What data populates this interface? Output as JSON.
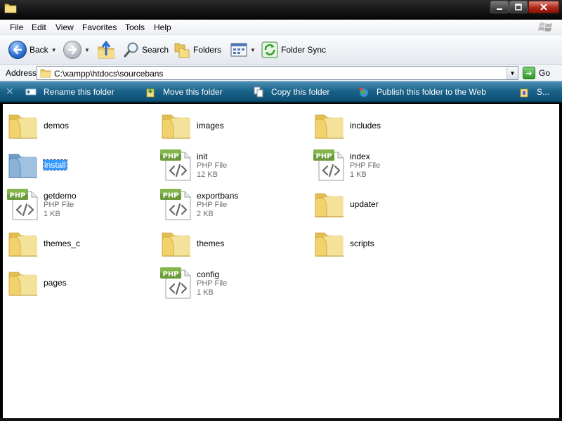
{
  "menu": [
    "File",
    "Edit",
    "View",
    "Favorites",
    "Tools",
    "Help"
  ],
  "toolbar": {
    "back_label": "Back",
    "search_label": "Search",
    "folders_label": "Folders",
    "folder_sync_label": "Folder Sync"
  },
  "address": {
    "label": "Address",
    "path": "C:\\xampp\\htdocs\\sourcebans",
    "go_label": "Go"
  },
  "tasks": [
    {
      "label": "Rename this folder"
    },
    {
      "label": "Move this folder"
    },
    {
      "label": "Copy this folder"
    },
    {
      "label": "Publish this folder to the Web"
    },
    {
      "label": "S..."
    }
  ],
  "items": [
    {
      "name": "demos",
      "kind": "folder"
    },
    {
      "name": "images",
      "kind": "folder"
    },
    {
      "name": "includes",
      "kind": "folder"
    },
    {
      "name": "install",
      "kind": "folder",
      "selected": true
    },
    {
      "name": "init",
      "kind": "file",
      "type": "PHP File",
      "size": "12 KB"
    },
    {
      "name": "index",
      "kind": "file",
      "type": "PHP File",
      "size": "1 KB"
    },
    {
      "name": "getdemo",
      "kind": "file",
      "type": "PHP File",
      "size": "1 KB"
    },
    {
      "name": "exportbans",
      "kind": "file",
      "type": "PHP File",
      "size": "2 KB"
    },
    {
      "name": "updater",
      "kind": "folder"
    },
    {
      "name": "themes_c",
      "kind": "folder"
    },
    {
      "name": "themes",
      "kind": "folder"
    },
    {
      "name": "scripts",
      "kind": "folder"
    },
    {
      "name": "pages",
      "kind": "folder"
    },
    {
      "name": "config",
      "kind": "file",
      "type": "PHP File",
      "size": "1 KB"
    }
  ],
  "icons": {
    "folder": "folder-icon",
    "php": "php-file-icon",
    "php_badge": "PHP"
  },
  "colors": {
    "taskbar": "#1a6289",
    "selection": "#3399ff",
    "folder": "#f2d36b"
  }
}
